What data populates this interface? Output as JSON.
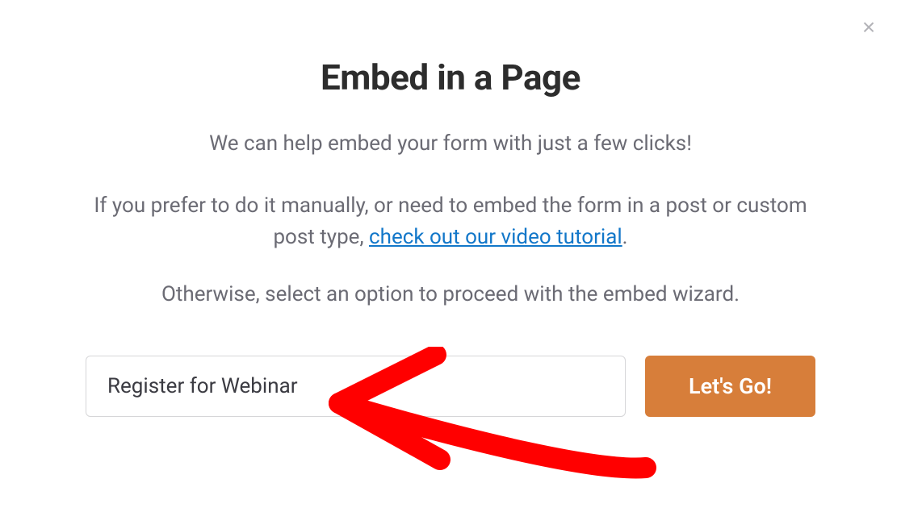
{
  "modal": {
    "title": "Embed in a Page",
    "subtitle": "We can help embed your form with just a few clicks!",
    "paragraph1_prefix": "If you prefer to do it manually, or need to embed the form in a post or custom post type, ",
    "tutorial_link_label": "check out our video tutorial",
    "paragraph1_suffix": ".",
    "paragraph2": "Otherwise, select an option to proceed with the embed wizard."
  },
  "form": {
    "page_name_value": "Register for Webinar",
    "go_button_label": "Let's Go!"
  },
  "icons": {
    "close": "×"
  }
}
